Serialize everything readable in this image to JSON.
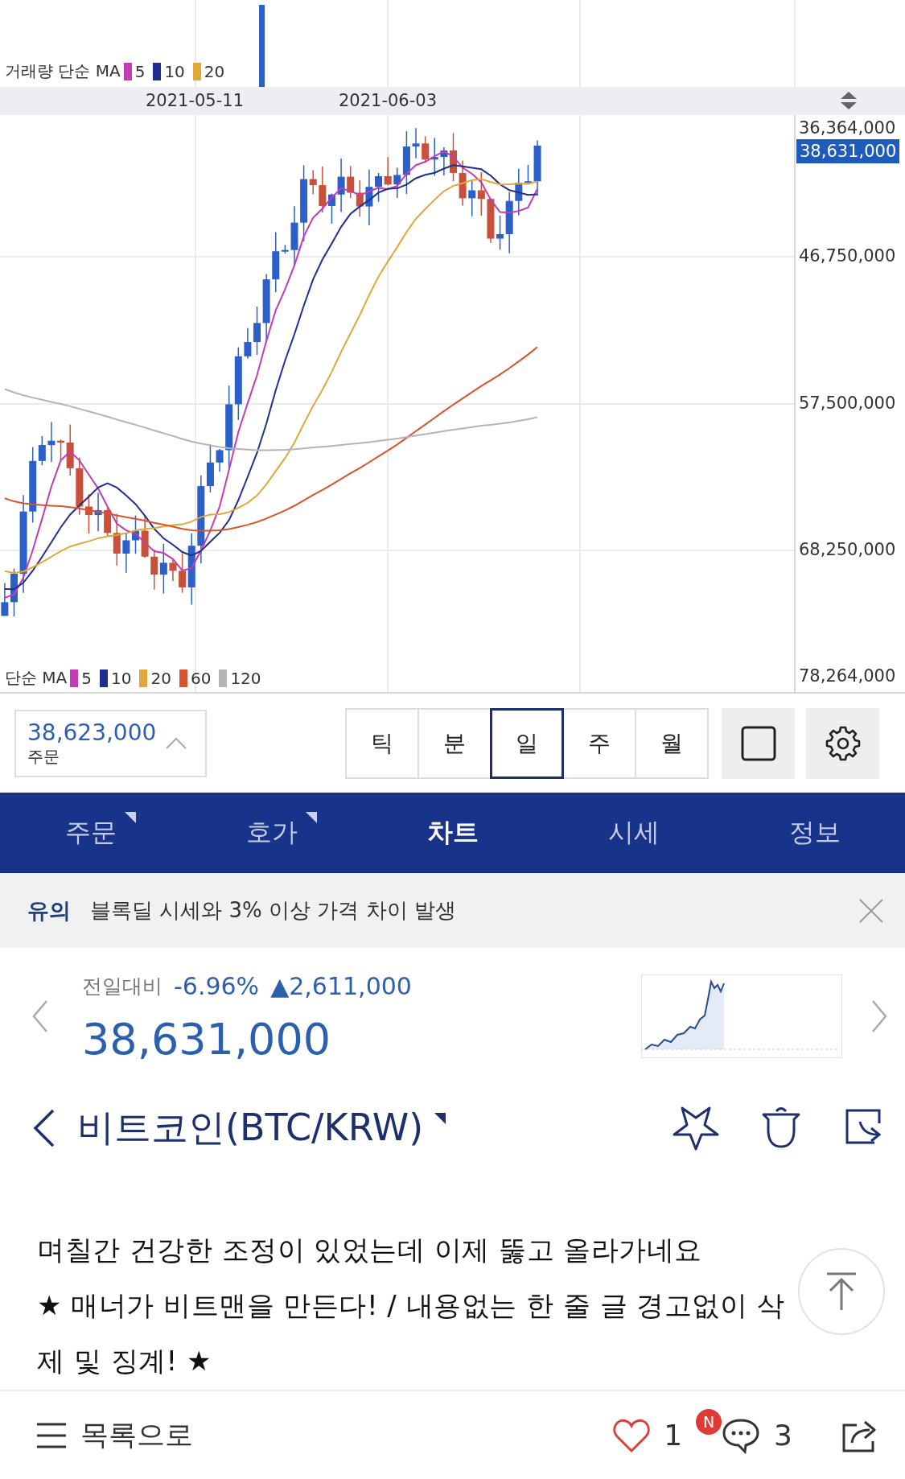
{
  "chart": {
    "volume_legend": {
      "title": "거래량 단순 MA",
      "items": [
        {
          "label": "5",
          "color": "#c43bb5"
        },
        {
          "label": "10",
          "color": "#1f2f8f"
        },
        {
          "label": "20",
          "color": "#e0a83a"
        }
      ]
    },
    "dates": [
      "2021-05-11",
      "2021-06-03"
    ],
    "price_axis": [
      "36,364,000",
      "46,750,000",
      "57,500,000",
      "68,250,000",
      "78,264,000"
    ],
    "current_price": "38,631,000",
    "legend": {
      "title": "단순 MA",
      "items": [
        {
          "label": "5",
          "color": "#c43bb5"
        },
        {
          "label": "10",
          "color": "#1f2f8f"
        },
        {
          "label": "20",
          "color": "#e0a83a"
        },
        {
          "label": "60",
          "color": "#d9532c"
        },
        {
          "label": "120",
          "color": "#b4b4b4"
        }
      ]
    }
  },
  "chart_controls": {
    "price_box": {
      "value": "38,623,000",
      "label": "주문"
    },
    "periods": [
      {
        "label": "틱",
        "selected": false
      },
      {
        "label": "분",
        "selected": false
      },
      {
        "label": "일",
        "selected": true
      },
      {
        "label": "주",
        "selected": false
      },
      {
        "label": "월",
        "selected": false
      }
    ]
  },
  "tabs": [
    {
      "label": "주문",
      "selected": false,
      "marked": true
    },
    {
      "label": "호가",
      "selected": false,
      "marked": true
    },
    {
      "label": "차트",
      "selected": true,
      "marked": false
    },
    {
      "label": "시세",
      "selected": false,
      "marked": false
    },
    {
      "label": "정보",
      "selected": false,
      "marked": false
    }
  ],
  "notice": {
    "tag": "유의",
    "text": "블록딜 시세와 3% 이상 가격 차이 발생"
  },
  "quote": {
    "change_label": "전일대비",
    "change_rate": "-6.96%",
    "change_arrow": "▲",
    "change_amount": "2,611,000",
    "price": "38,631,000"
  },
  "title_bar": {
    "title": "비트코인(BTC/KRW)"
  },
  "post": {
    "lines": [
      "며칠간 건강한 조정이 있었는데 이제 뚫고 올라가네요",
      "★ 매너가 비트맨을 만든다! / 내용없는 한 줄 글 경고없이 삭",
      "제 및 징계! ★"
    ]
  },
  "footer": {
    "list_label": "목록으로",
    "likes": "1",
    "comment_badge": "N",
    "comments": "3"
  }
}
